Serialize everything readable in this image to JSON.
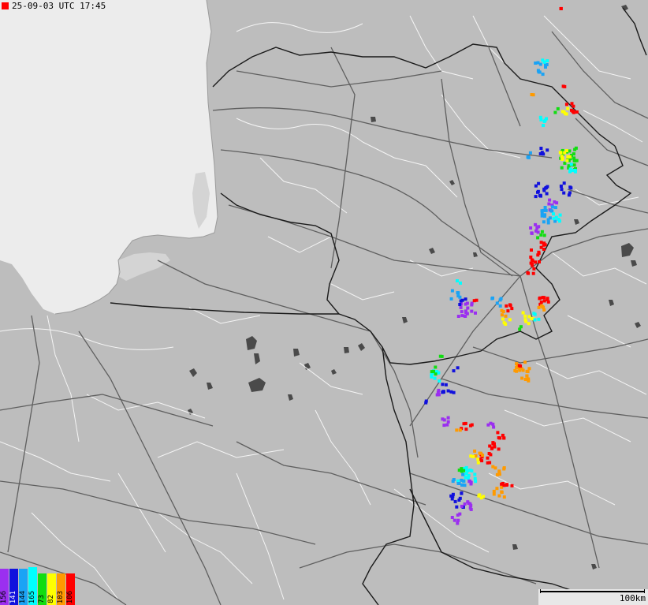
{
  "header": {
    "timestamp": "25-09-03 UTC 17:45",
    "indicator_color": "#ff0000"
  },
  "colors": {
    "land": "#bdbdbd",
    "water": "#ececec",
    "lake": "#4a4a4a",
    "border": "#1a1a1a",
    "roads": "#5f5f5f",
    "admin": "#ffffff"
  },
  "legend": [
    {
      "label": "156",
      "color": "#9b2ff0"
    },
    {
      "label": "141",
      "color": "#1111dd"
    },
    {
      "label": "144",
      "color": "#1aa3f5"
    },
    {
      "label": "165",
      "color": "#00ffff"
    },
    {
      "label": "73",
      "color": "#11dd11"
    },
    {
      "label": "82",
      "color": "#ffff00"
    },
    {
      "label": "103",
      "color": "#ff9a00"
    },
    {
      "label": "106",
      "color": "#ff0000"
    }
  ],
  "scale": {
    "label": "100km"
  }
}
